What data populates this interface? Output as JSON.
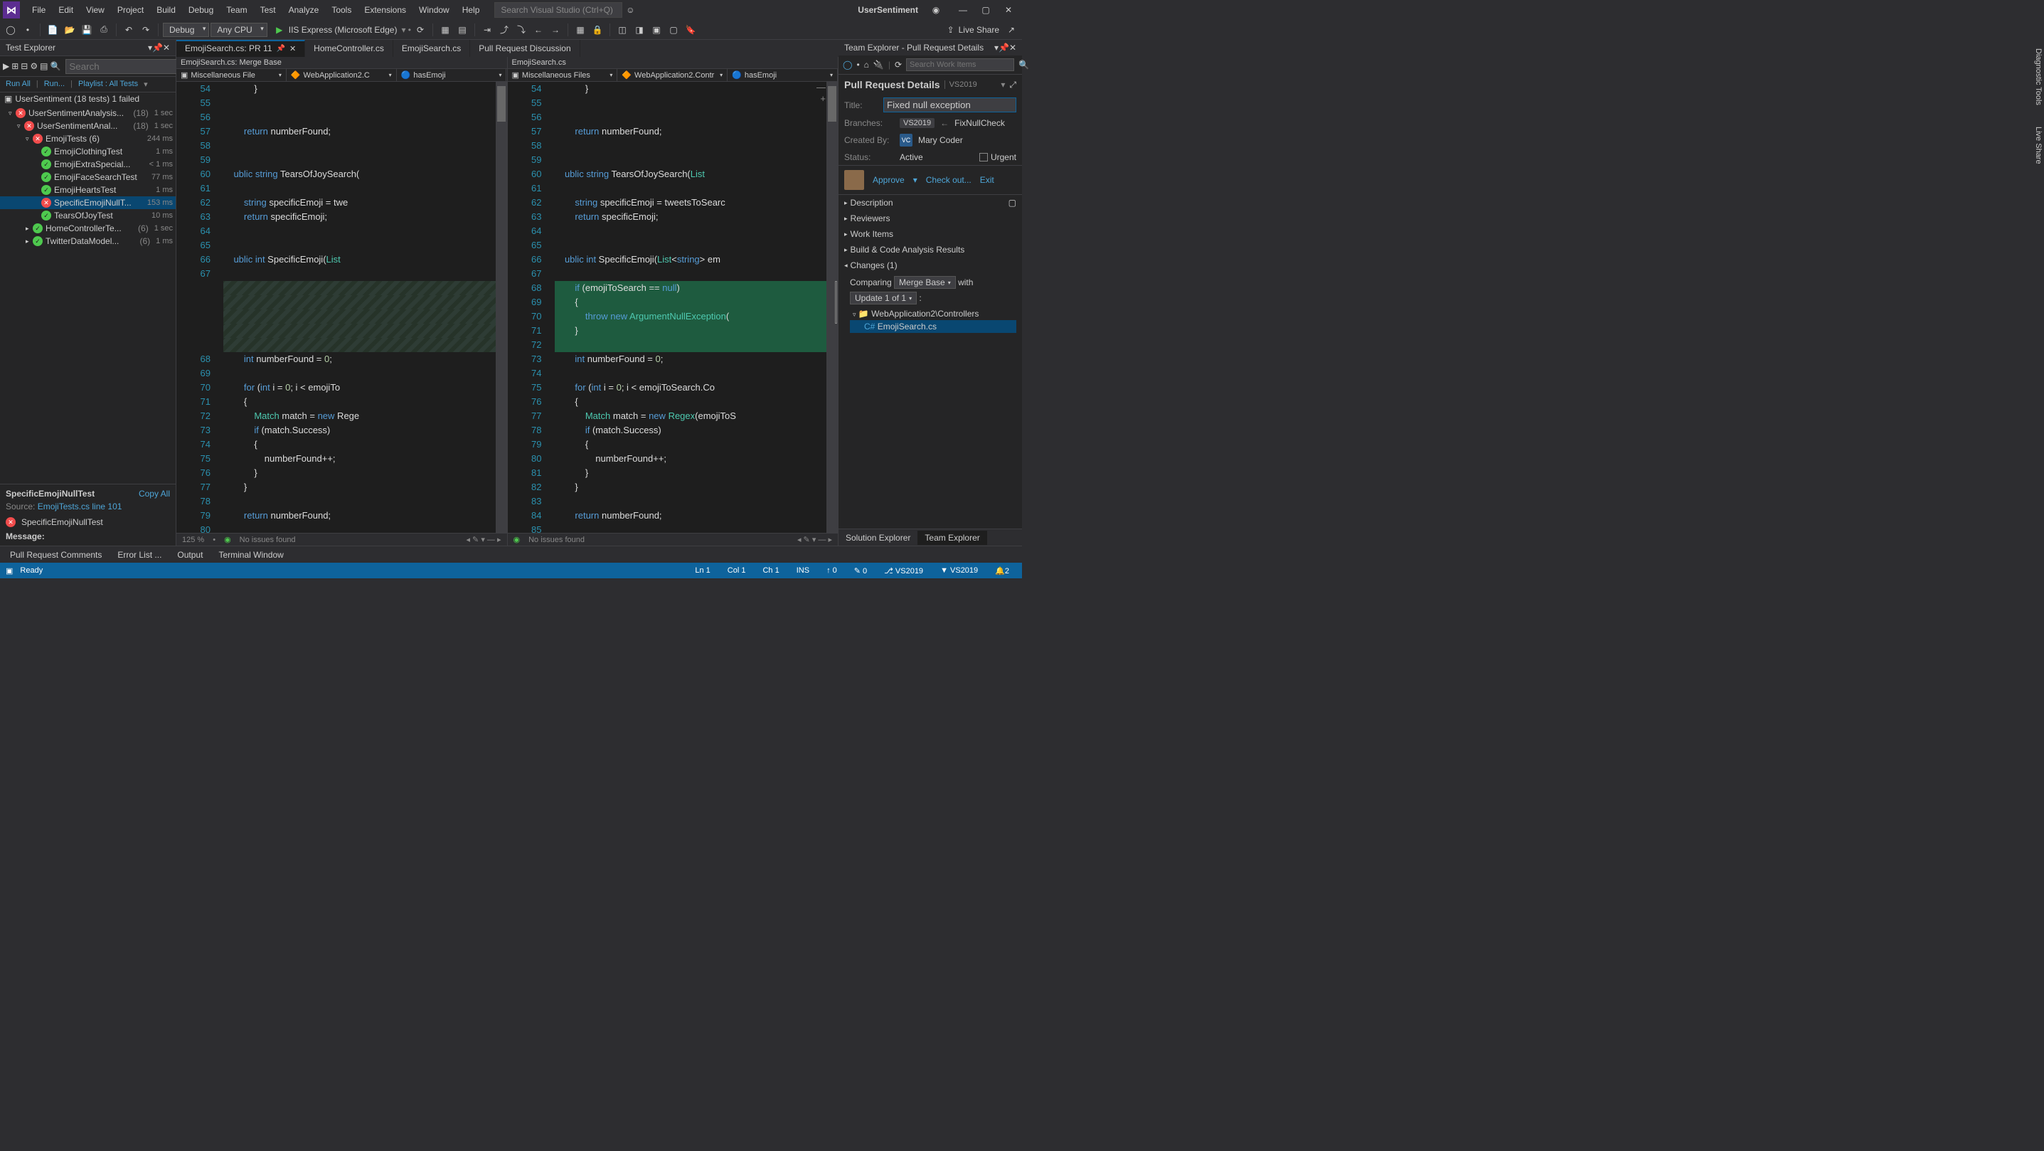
{
  "title": "UserSentiment",
  "menu": [
    "File",
    "Edit",
    "View",
    "Project",
    "Build",
    "Debug",
    "Team",
    "Test",
    "Analyze",
    "Tools",
    "Extensions",
    "Window",
    "Help"
  ],
  "titlebarSearch": "Search Visual Studio (Ctrl+Q)",
  "toolbar": {
    "configs": "Debug",
    "platform": "Any CPU",
    "run": "IIS Express (Microsoft Edge)",
    "liveShare": "Live Share"
  },
  "testExplorer": {
    "title": "Test Explorer",
    "searchPlaceholder": "Search",
    "links": {
      "runAll": "Run All",
      "run": "Run...",
      "playlist": "Playlist : All Tests"
    },
    "root": {
      "label": "UserSentiment (18 tests) 1 failed"
    },
    "tree": [
      {
        "indent": 1,
        "exp": "▿",
        "status": "fail",
        "label": "UserSentimentAnalysis...",
        "count": "(18)",
        "time": "1 sec"
      },
      {
        "indent": 2,
        "exp": "▿",
        "status": "fail",
        "label": "UserSentimentAnal...",
        "count": "(18)",
        "time": "1 sec"
      },
      {
        "indent": 3,
        "exp": "▿",
        "status": "fail",
        "label": "EmojiTests (6)",
        "count": "",
        "time": "244 ms"
      },
      {
        "indent": 4,
        "exp": "",
        "status": "pass",
        "label": "EmojiClothingTest",
        "count": "",
        "time": "1 ms"
      },
      {
        "indent": 4,
        "exp": "",
        "status": "pass",
        "label": "EmojiExtraSpecial...",
        "count": "",
        "time": "< 1 ms"
      },
      {
        "indent": 4,
        "exp": "",
        "status": "pass",
        "label": "EmojiFaceSearchTest",
        "count": "",
        "time": "77 ms"
      },
      {
        "indent": 4,
        "exp": "",
        "status": "pass",
        "label": "EmojiHeartsTest",
        "count": "",
        "time": "1 ms"
      },
      {
        "indent": 4,
        "exp": "",
        "status": "fail",
        "label": "SpecificEmojiNullT...",
        "count": "",
        "time": "153 ms",
        "selected": true
      },
      {
        "indent": 4,
        "exp": "",
        "status": "pass",
        "label": "TearsOfJoyTest",
        "count": "",
        "time": "10 ms"
      },
      {
        "indent": 3,
        "exp": "▸",
        "status": "pass",
        "label": "HomeControllerTe...",
        "count": "(6)",
        "time": "1 sec"
      },
      {
        "indent": 3,
        "exp": "▸",
        "status": "pass",
        "label": "TwitterDataModel...",
        "count": "(6)",
        "time": "1 ms"
      }
    ],
    "detail": {
      "name": "SpecificEmojiNullTest",
      "copy": "Copy All",
      "sourceLabel": "Source:",
      "sourceLink": "EmojiTests.cs line 101",
      "failName": "SpecificEmojiNullTest",
      "messageLabel": "Message:"
    }
  },
  "tabs": [
    {
      "label": "EmojiSearch.cs: PR 11",
      "active": true,
      "pinned": true,
      "close": true
    },
    {
      "label": "HomeController.cs"
    },
    {
      "label": "EmojiSearch.cs"
    },
    {
      "label": "Pull Request Discussion"
    }
  ],
  "leftPane": {
    "header": "EmojiSearch.cs: Merge Base",
    "nav": [
      "Miscellaneous File",
      "WebApplication2.C",
      "hasEmoji"
    ],
    "lines": [
      {
        "n": 54,
        "t": "            }"
      },
      {
        "n": 55,
        "t": ""
      },
      {
        "n": 56,
        "t": ""
      },
      {
        "n": 57,
        "t": "        return numberFound;",
        "kw": [
          "return"
        ]
      },
      {
        "n": 58,
        "t": ""
      },
      {
        "n": 59,
        "t": ""
      },
      {
        "n": 60,
        "t": "    ublic string TearsOfJoySearch(",
        "kw": [
          "ublic",
          "string"
        ]
      },
      {
        "n": 61,
        "t": ""
      },
      {
        "n": 62,
        "t": "        string specificEmoji = twe",
        "kw": [
          "string"
        ]
      },
      {
        "n": 63,
        "t": "        return specificEmoji;",
        "kw": [
          "return"
        ]
      },
      {
        "n": 64,
        "t": ""
      },
      {
        "n": 65,
        "t": ""
      },
      {
        "n": 66,
        "t": "    ublic int SpecificEmoji(List<s",
        "kw": [
          "ublic",
          "int"
        ],
        "types": [
          "List"
        ]
      },
      {
        "n": 67,
        "t": ""
      },
      {
        "n": "",
        "t": "",
        "diff": "old"
      },
      {
        "n": "",
        "t": "",
        "diff": "old"
      },
      {
        "n": "",
        "t": "",
        "diff": "old"
      },
      {
        "n": "",
        "t": "",
        "diff": "old"
      },
      {
        "n": "",
        "t": "",
        "diff": "old"
      },
      {
        "n": 68,
        "t": "        int numberFound = 0;",
        "kw": [
          "int"
        ]
      },
      {
        "n": 69,
        "t": ""
      },
      {
        "n": 70,
        "t": "        for (int i = 0; i < emojiTo",
        "kw": [
          "for",
          "int"
        ]
      },
      {
        "n": 71,
        "t": "        {"
      },
      {
        "n": 72,
        "t": "            Match match = new Rege",
        "kw": [
          "new"
        ],
        "types": [
          "Match"
        ]
      },
      {
        "n": 73,
        "t": "            if (match.Success)",
        "kw": [
          "if"
        ]
      },
      {
        "n": 74,
        "t": "            {"
      },
      {
        "n": 75,
        "t": "                numberFound++;"
      },
      {
        "n": 76,
        "t": "            }"
      },
      {
        "n": 77,
        "t": "        }"
      },
      {
        "n": 78,
        "t": ""
      },
      {
        "n": 79,
        "t": "        return numberFound;",
        "kw": [
          "return"
        ]
      },
      {
        "n": 80,
        "t": ""
      }
    ],
    "zoom": "125 %",
    "issues": "No issues found"
  },
  "rightPane": {
    "header": "EmojiSearch.cs",
    "nav": [
      "Miscellaneous Files",
      "WebApplication2.Contr",
      "hasEmoji"
    ],
    "lines": [
      {
        "n": 54,
        "t": "            }"
      },
      {
        "n": 55,
        "t": ""
      },
      {
        "n": 56,
        "t": ""
      },
      {
        "n": 57,
        "t": "        return numberFound;",
        "kw": [
          "return"
        ]
      },
      {
        "n": 58,
        "t": ""
      },
      {
        "n": 59,
        "t": ""
      },
      {
        "n": 60,
        "t": "    ublic string TearsOfJoySearch(List<stri",
        "kw": [
          "ublic",
          "string"
        ],
        "types": [
          "List"
        ]
      },
      {
        "n": 61,
        "t": ""
      },
      {
        "n": 62,
        "t": "        string specificEmoji = tweetsToSearc",
        "kw": [
          "string"
        ]
      },
      {
        "n": 63,
        "t": "        return specificEmoji;",
        "kw": [
          "return"
        ]
      },
      {
        "n": 64,
        "t": ""
      },
      {
        "n": 65,
        "t": ""
      },
      {
        "n": 66,
        "t": "    ublic int SpecificEmoji(List<string> em",
        "kw": [
          "ublic",
          "int",
          "string"
        ],
        "types": [
          "List"
        ]
      },
      {
        "n": 67,
        "t": ""
      },
      {
        "n": 68,
        "t": "        if (emojiToSearch == null)",
        "kw": [
          "if",
          "null"
        ],
        "diff": "new"
      },
      {
        "n": 69,
        "t": "        {",
        "diff": "new"
      },
      {
        "n": 70,
        "t": "            throw new ArgumentNullException(",
        "kw": [
          "throw",
          "new"
        ],
        "types": [
          "ArgumentNullException"
        ],
        "diff": "new"
      },
      {
        "n": 71,
        "t": "        }",
        "diff": "new"
      },
      {
        "n": 72,
        "t": "",
        "diff": "new"
      },
      {
        "n": 73,
        "t": "        int numberFound = 0;",
        "kw": [
          "int"
        ]
      },
      {
        "n": 74,
        "t": ""
      },
      {
        "n": 75,
        "t": "        for (int i = 0; i < emojiToSearch.Co",
        "kw": [
          "for",
          "int"
        ]
      },
      {
        "n": 76,
        "t": "        {"
      },
      {
        "n": 77,
        "t": "            Match match = new Regex(emojiToS",
        "kw": [
          "new"
        ],
        "types": [
          "Match",
          "Regex"
        ]
      },
      {
        "n": 78,
        "t": "            if (match.Success)",
        "kw": [
          "if"
        ]
      },
      {
        "n": 79,
        "t": "            {"
      },
      {
        "n": 80,
        "t": "                numberFound++;"
      },
      {
        "n": 81,
        "t": "            }"
      },
      {
        "n": 82,
        "t": "        }"
      },
      {
        "n": 83,
        "t": ""
      },
      {
        "n": 84,
        "t": "        return numberFound;",
        "kw": [
          "return"
        ]
      },
      {
        "n": 85,
        "t": ""
      }
    ],
    "issues": "No issues found"
  },
  "teamExplorer": {
    "title": "Team Explorer - Pull Request Details",
    "searchPlaceholder": "Search Work Items",
    "pageTitle": "Pull Request Details",
    "pageSub": "VS2019",
    "fields": {
      "titleLabel": "Title:",
      "titleVal": "Fixed null exception",
      "branchesLabel": "Branches:",
      "branchTarget": "VS2019",
      "branchSource": "FixNullCheck",
      "createdByLabel": "Created By:",
      "createdByInitials": "VC",
      "createdBy": "Mary Coder",
      "statusLabel": "Status:",
      "statusVal": "Active",
      "urgent": "Urgent"
    },
    "actions": {
      "approve": "Approve",
      "checkout": "Check out...",
      "exit": "Exit"
    },
    "sections": [
      "Description",
      "Reviewers",
      "Work Items",
      "Build & Code Analysis Results"
    ],
    "changes": {
      "title": "Changes (1)",
      "comparing": "Comparing",
      "mergeBase": "Merge Base",
      "with": "with",
      "update": "Update 1 of 1",
      "folder": "WebApplication2\\Controllers",
      "file": "EmojiSearch.cs"
    },
    "bottomTabs": {
      "solution": "Solution Explorer",
      "team": "Team Explorer"
    }
  },
  "bottomTabs": [
    "Pull Request Comments",
    "Error List ...",
    "Output",
    "Terminal Window"
  ],
  "verticalTabs": [
    "Diagnostic Tools",
    "Live Share"
  ],
  "statusbar": {
    "ready": "Ready",
    "ln": "Ln 1",
    "col": "Col 1",
    "ch": "Ch 1",
    "ins": "INS",
    "upload": "0",
    "edits": "0",
    "branch": "VS2019",
    "repo": "VS2019",
    "notif": "2"
  }
}
